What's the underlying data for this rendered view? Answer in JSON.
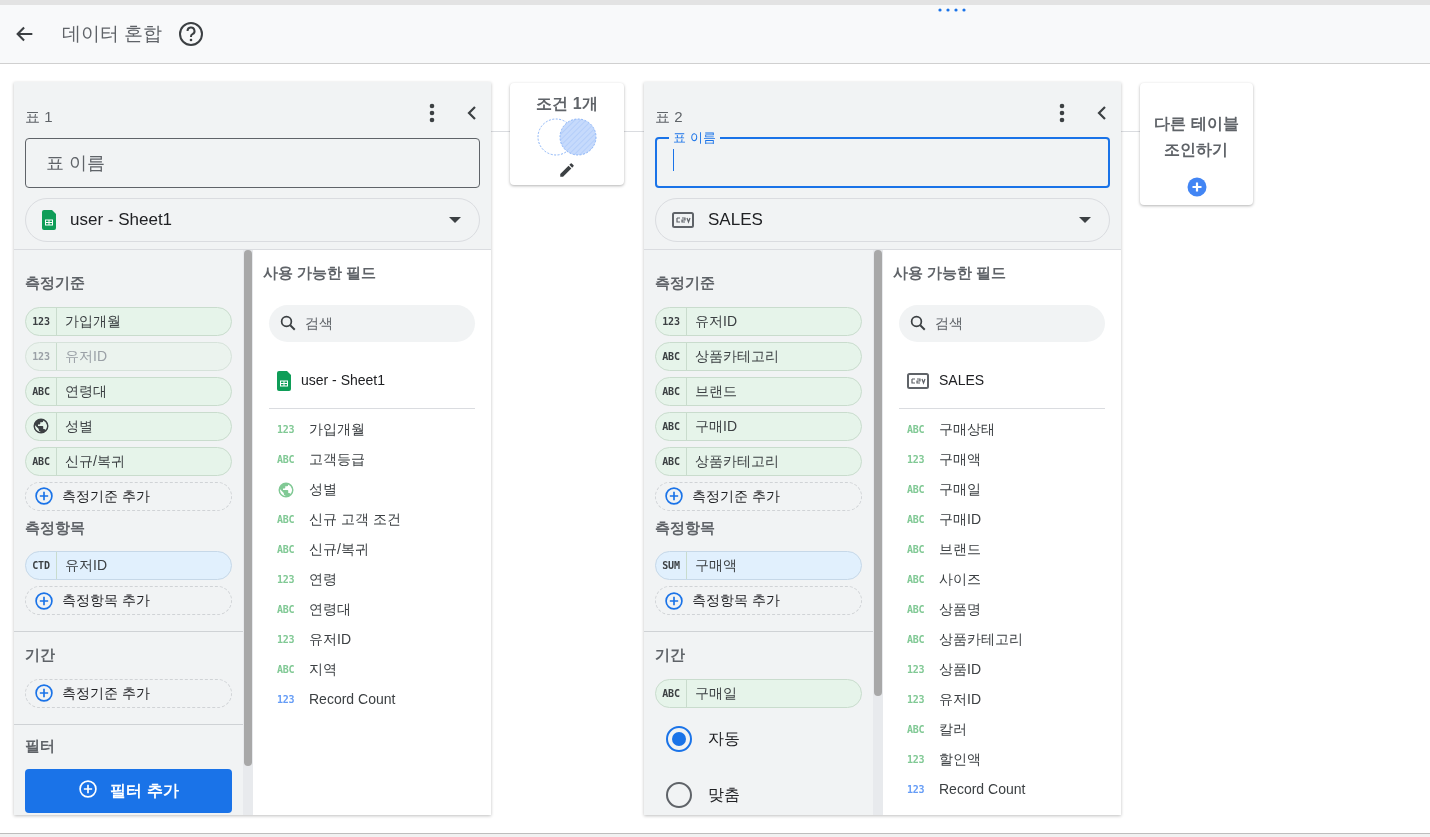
{
  "header": {
    "title": "데이터 혼합"
  },
  "tables": [
    {
      "title": "표 1",
      "name_field": {
        "label": "표 이름",
        "focused": false
      },
      "source": {
        "kind": "sheets",
        "label": "user - Sheet1"
      },
      "dimensions": {
        "title": "측정기준",
        "chips": [
          {
            "kind": "dimension",
            "tag": "123",
            "label": "가입개월",
            "disabled": false
          },
          {
            "kind": "dimension",
            "tag": "123",
            "label": "유저ID",
            "disabled": true
          },
          {
            "kind": "dimension",
            "tag": "ABC",
            "label": "연령대",
            "disabled": false
          },
          {
            "kind": "dimension",
            "icon": {
              "kind": "geo"
            },
            "label": "성별",
            "disabled": false
          },
          {
            "kind": "dimension",
            "tag": "ABC",
            "label": "신규/복귀",
            "disabled": false
          }
        ],
        "add_label": "측정기준 추가"
      },
      "metrics": {
        "title": "측정항목",
        "chips": [
          {
            "kind": "metric",
            "tag": "CTD",
            "label": "유저ID",
            "disabled": false
          }
        ],
        "add_label": "측정항목 추가"
      },
      "date_range": {
        "title": "기간",
        "add_label": "측정기준 추가"
      },
      "filter": {
        "title": "필터",
        "button": "필터 추가"
      },
      "fields": {
        "title": "사용 가능한 필드",
        "search_placeholder": "검색",
        "source": {
          "kind": "sheets",
          "label": "user - Sheet1"
        },
        "items": [
          {
            "tag": "123",
            "label": "가입개월",
            "color": "#81c995"
          },
          {
            "tag": "ABC",
            "label": "고객등급",
            "color": "#81c995"
          },
          {
            "icon": {
              "kind": "geo"
            },
            "label": "성별",
            "color": "#81c995"
          },
          {
            "tag": "ABC",
            "label": "신규 고객 조건",
            "color": "#81c995"
          },
          {
            "tag": "ABC",
            "label": "신규/복귀",
            "color": "#81c995"
          },
          {
            "tag": "123",
            "label": "연령",
            "color": "#81c995"
          },
          {
            "tag": "ABC",
            "label": "연령대",
            "color": "#81c995"
          },
          {
            "tag": "123",
            "label": "유저ID",
            "color": "#81c995"
          },
          {
            "tag": "ABC",
            "label": "지역",
            "color": "#81c995"
          },
          {
            "tag": "123",
            "label": "Record Count",
            "color": "#669df6"
          }
        ]
      }
    },
    {
      "title": "표 2",
      "name_field": {
        "label": "표 이름",
        "focused": true
      },
      "source": {
        "kind": "csv",
        "label": "SALES"
      },
      "dimensions": {
        "title": "측정기준",
        "chips": [
          {
            "kind": "dimension",
            "tag": "123",
            "label": "유저ID",
            "disabled": false
          },
          {
            "kind": "dimension",
            "tag": "ABC",
            "label": "상품카테고리",
            "disabled": false
          },
          {
            "kind": "dimension",
            "tag": "ABC",
            "label": "브랜드",
            "disabled": false
          },
          {
            "kind": "dimension",
            "tag": "ABC",
            "label": "구매ID",
            "disabled": false
          },
          {
            "kind": "dimension",
            "tag": "ABC",
            "label": "상품카테고리",
            "disabled": false
          }
        ],
        "add_label": "측정기준 추가"
      },
      "metrics": {
        "title": "측정항목",
        "chips": [
          {
            "kind": "metric",
            "tag": "SUM",
            "label": "구매액",
            "disabled": false
          }
        ],
        "add_label": "측정항목 추가"
      },
      "date_range": {
        "title": "기간",
        "chips": [
          {
            "kind": "dimension",
            "tag": "ABC",
            "label": "구매일",
            "disabled": false
          }
        ],
        "options": [
          {
            "label": "자동",
            "selected": true
          },
          {
            "label": "맞춤",
            "selected": false
          }
        ]
      },
      "fields": {
        "title": "사용 가능한 필드",
        "search_placeholder": "검색",
        "source": {
          "kind": "csv",
          "label": "SALES"
        },
        "items": [
          {
            "tag": "ABC",
            "label": "구매상태",
            "color": "#81c995"
          },
          {
            "tag": "123",
            "label": "구매액",
            "color": "#81c995"
          },
          {
            "tag": "ABC",
            "label": "구매일",
            "color": "#81c995"
          },
          {
            "tag": "ABC",
            "label": "구매ID",
            "color": "#81c995"
          },
          {
            "tag": "ABC",
            "label": "브랜드",
            "color": "#81c995"
          },
          {
            "tag": "ABC",
            "label": "사이즈",
            "color": "#81c995"
          },
          {
            "tag": "ABC",
            "label": "상품명",
            "color": "#81c995"
          },
          {
            "tag": "ABC",
            "label": "상품카테고리",
            "color": "#81c995"
          },
          {
            "tag": "123",
            "label": "상품ID",
            "color": "#81c995"
          },
          {
            "tag": "123",
            "label": "유저ID",
            "color": "#81c995"
          },
          {
            "tag": "ABC",
            "label": "칼러",
            "color": "#81c995"
          },
          {
            "tag": "123",
            "label": "할인액",
            "color": "#81c995"
          },
          {
            "tag": "123",
            "label": "Record Count",
            "color": "#669df6"
          }
        ]
      }
    }
  ],
  "join_card": {
    "label": "조건 1개"
  },
  "add_table_card": {
    "label": "다른 테이블\n조인하기"
  }
}
